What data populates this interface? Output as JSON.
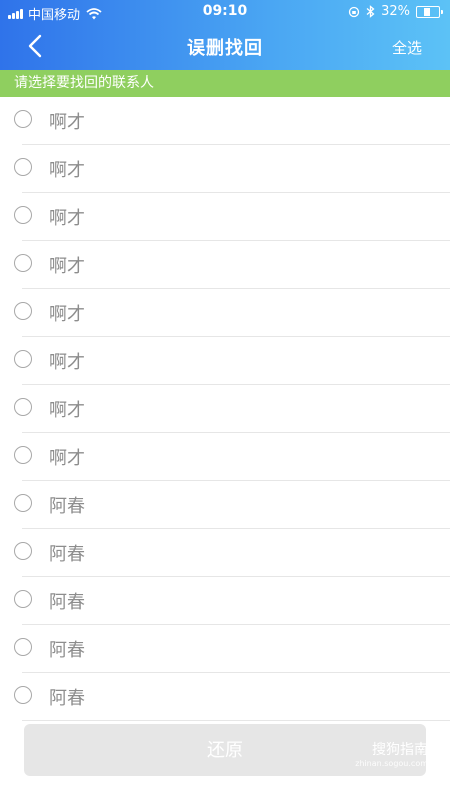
{
  "status_bar": {
    "carrier": "中国移动",
    "time": "09:10",
    "battery": "32%",
    "battery_level": 0.32
  },
  "nav": {
    "title": "误删找回",
    "select_all": "全选"
  },
  "hint": "请选择要找回的联系人",
  "contacts": [
    {
      "name": "啊才"
    },
    {
      "name": "啊才"
    },
    {
      "name": "啊才"
    },
    {
      "name": "啊才"
    },
    {
      "name": "啊才"
    },
    {
      "name": "啊才"
    },
    {
      "name": "啊才"
    },
    {
      "name": "啊才"
    },
    {
      "name": "阿春"
    },
    {
      "name": "阿春"
    },
    {
      "name": "阿春"
    },
    {
      "name": "阿春"
    },
    {
      "name": "阿春"
    }
  ],
  "restore_button": "还原",
  "watermark": {
    "text": "搜狗指南",
    "sub": "zhinan.sogou.com"
  }
}
